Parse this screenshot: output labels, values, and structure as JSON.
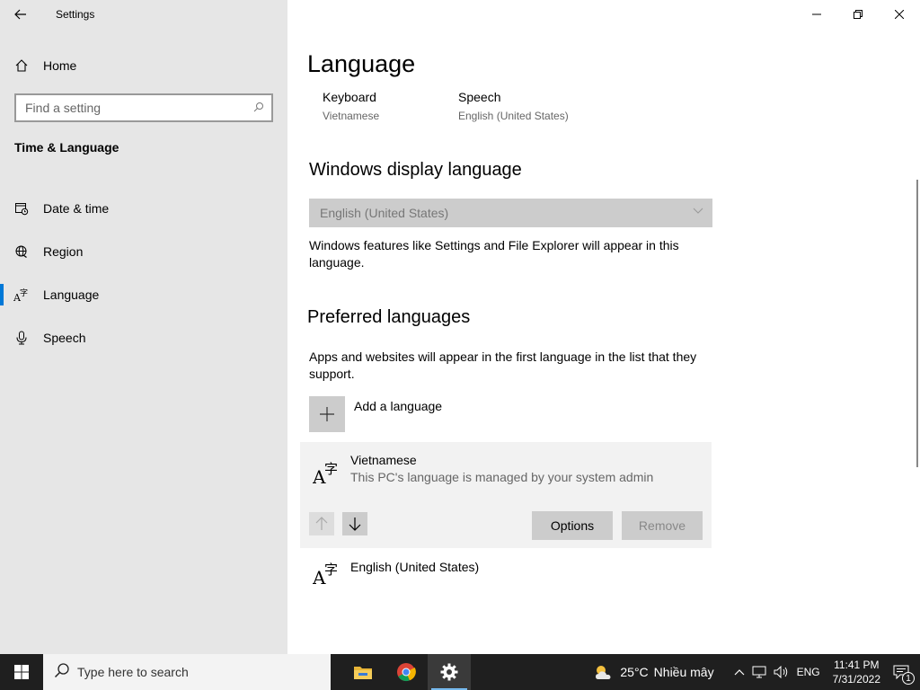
{
  "app": {
    "title": "Settings"
  },
  "sidebar": {
    "home_label": "Home",
    "search_placeholder": "Find a setting",
    "section_title": "Time & Language",
    "items": [
      {
        "label": "Date & time",
        "icon": "calendar-clock-icon"
      },
      {
        "label": "Region",
        "icon": "globe-icon"
      },
      {
        "label": "Language",
        "icon": "language-icon",
        "active": true
      },
      {
        "label": "Speech",
        "icon": "microphone-icon"
      }
    ]
  },
  "main": {
    "title": "Language",
    "quick_links": [
      {
        "title": "Keyboard",
        "subtitle": "Vietnamese"
      },
      {
        "title": "Speech",
        "subtitle": "English (United States)"
      }
    ],
    "display_language": {
      "heading": "Windows display language",
      "selected": "English (United States)",
      "description": "Windows features like Settings and File Explorer will appear in this language."
    },
    "preferred": {
      "heading": "Preferred languages",
      "description": "Apps and websites will appear in the first language in the list that they support.",
      "add_label": "Add a language",
      "languages": [
        {
          "name": "Vietnamese",
          "subtitle": "This PC's language is managed by your system admin",
          "selected": true
        },
        {
          "name": "English (United States)"
        }
      ],
      "options_label": "Options",
      "remove_label": "Remove"
    }
  },
  "taskbar": {
    "search_placeholder": "Type here to search",
    "weather_temp": "25°C",
    "weather_desc": "Nhiều mây",
    "lang": "ENG",
    "time": "11:41 PM",
    "date": "7/31/2022",
    "notification_count": "1"
  },
  "colors": {
    "accent": "#0078d7",
    "sidebar_bg": "#e6e6e6",
    "taskbar_bg": "#1f1f1f"
  }
}
